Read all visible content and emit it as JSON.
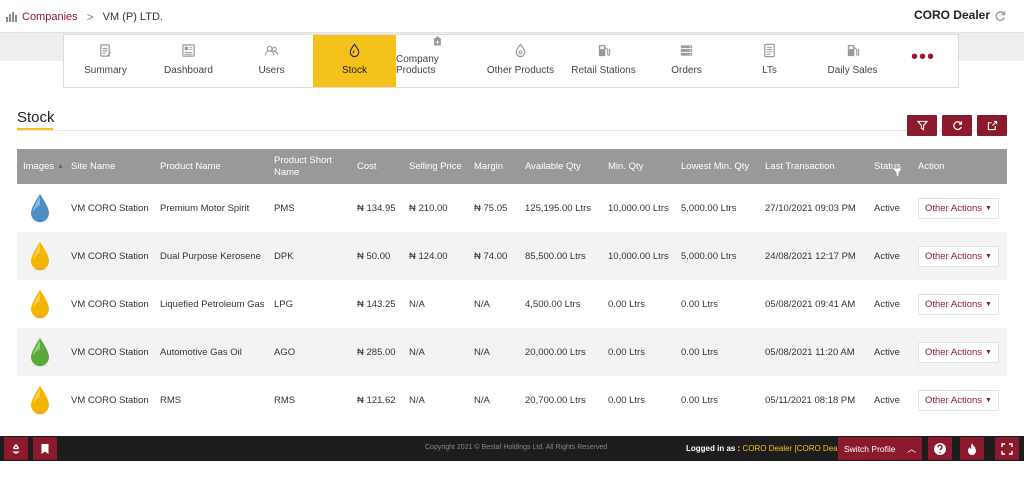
{
  "breadcrumb": {
    "root": "Companies",
    "separator": ">",
    "company": "VM (P) LTD."
  },
  "header": {
    "user_title": "CORO Dealer"
  },
  "nav": {
    "tabs": [
      {
        "label": "Summary",
        "icon": "clipboard-icon",
        "active": false
      },
      {
        "label": "Dashboard",
        "icon": "dashboard-icon",
        "active": false
      },
      {
        "label": "Users",
        "icon": "users-icon",
        "active": false
      },
      {
        "label": "Stock",
        "icon": "fuel-drop-icon",
        "active": true
      },
      {
        "label": "Company Products",
        "icon": "oil-can-icon",
        "active": false
      },
      {
        "label": "Other Products",
        "icon": "drop-icon",
        "active": false
      },
      {
        "label": "Retail Stations",
        "icon": "fuel-pump-icon",
        "active": false
      },
      {
        "label": "Orders",
        "icon": "server-icon",
        "active": false
      },
      {
        "label": "LTs",
        "icon": "document-list-icon",
        "active": false
      },
      {
        "label": "Daily Sales",
        "icon": "fuel-pump-icon",
        "active": false
      }
    ],
    "more_label": "•••"
  },
  "page": {
    "title": "Stock"
  },
  "table": {
    "columns": [
      "Images",
      "Site Name",
      "Product Name",
      "Product Short Name",
      "Cost",
      "Selling Price",
      "Margin",
      "Available Qty",
      "Min. Qty",
      "Lowest Min. Qty",
      "Last Transaction",
      "Status",
      "Action"
    ],
    "rows": [
      {
        "drop_color": "#4a8fc4",
        "drop_light": "#bcd9ee",
        "site": "VM CORO Station",
        "product": "Premium Motor Spirit",
        "short": "PMS",
        "cost": "₦ 134.95",
        "selling": "₦ 210.00",
        "margin": "₦ 75.05",
        "available": "125,195.00 Ltrs",
        "min": "10,000.00 Ltrs",
        "lowest": "5,000.00 Ltrs",
        "last": "27/10/2021 09:03 PM",
        "status": "Active",
        "action": "Other Actions"
      },
      {
        "drop_color": "#f5b400",
        "drop_light": "#fde68a",
        "site": "VM CORO Station",
        "product": "Dual Purpose Kerosene",
        "short": "DPK",
        "cost": "₦ 50.00",
        "selling": "₦ 124.00",
        "margin": "₦ 74.00",
        "available": "85,500.00 Ltrs",
        "min": "10,000.00 Ltrs",
        "lowest": "5,000.00 Ltrs",
        "last": "24/08/2021 12:17 PM",
        "status": "Active",
        "action": "Other Actions"
      },
      {
        "drop_color": "#f5b400",
        "drop_light": "#fde68a",
        "site": "VM CORO Station",
        "product": "Liquefied Petroleum Gas",
        "short": "LPG",
        "cost": "₦ 143.25",
        "selling": "N/A",
        "margin": "N/A",
        "available": "4,500.00 Ltrs",
        "min": "0.00 Ltrs",
        "lowest": "0.00 Ltrs",
        "last": "05/08/2021 09:41 AM",
        "status": "Active",
        "action": "Other Actions"
      },
      {
        "drop_color": "#5aaa3a",
        "drop_light": "#bfe3a8",
        "site": "VM CORO Station",
        "product": "Automotive Gas Oil",
        "short": "AGO",
        "cost": "₦ 285.00",
        "selling": "N/A",
        "margin": "N/A",
        "available": "20,000.00 Ltrs",
        "min": "0.00 Ltrs",
        "lowest": "0.00 Ltrs",
        "last": "05/08/2021 11:20 AM",
        "status": "Active",
        "action": "Other Actions"
      },
      {
        "drop_color": "#f5b400",
        "drop_light": "#fde68a",
        "site": "VM CORO Station",
        "product": "RMS",
        "short": "RMS",
        "cost": "₦ 121.62",
        "selling": "N/A",
        "margin": "N/A",
        "available": "20,700.00 Ltrs",
        "min": "0.00 Ltrs",
        "lowest": "0.00 Ltrs",
        "last": "05/11/2021 08:18 PM",
        "status": "Active",
        "action": "Other Actions"
      }
    ]
  },
  "footer": {
    "copyright": "Copyright 2021 © Bestaf Holdings Ltd. All Rights Reserved",
    "logged_label": "Logged in as :",
    "logged_user": "CORO Dealer [CORO Dealer]",
    "switch_label": "Switch Profile"
  },
  "colors": {
    "brand": "#8b1a2e",
    "accent": "#f5c21b",
    "header_gray": "#999999"
  }
}
